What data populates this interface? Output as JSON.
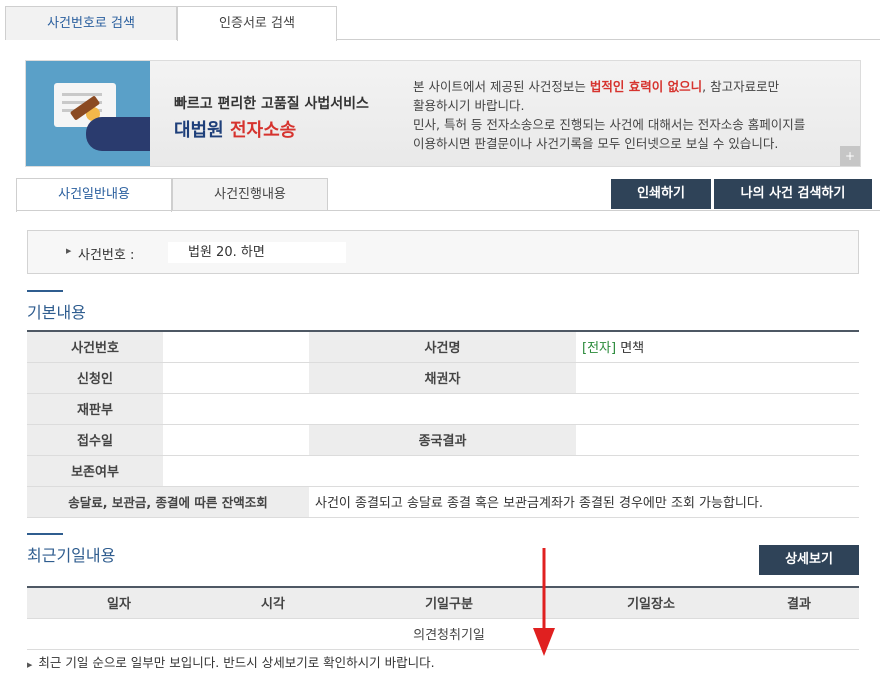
{
  "top_tabs": [
    "사건번호로 검색",
    "인증서로 검색"
  ],
  "banner": {
    "title1": "빠르고 편리한 고품질 사법서비스",
    "title2_a": "대법원",
    "title2_b": "전자소송",
    "text_line1_a": "본 사이트에서 제공된 사건정보는 ",
    "text_line1_red": "법적인 효력이 없으니",
    "text_line1_b": ", 참고자료로만",
    "text_line2": "활용하시기 바랍니다.",
    "text_line3": "민사, 특허 등 전자소송으로 진행되는 사건에 대해서는 전자소송 홈페이지를",
    "text_line4": "이용하시면 판결문이나 사건기록을 모두 인터넷으로 보실 수 있습니다.",
    "plus": "+"
  },
  "detail_tabs": [
    "사건일반내용",
    "사건진행내용"
  ],
  "buttons": {
    "print": "인쇄하기",
    "my_case": "나의 사건 검색하기",
    "detail": "상세보기"
  },
  "case_box": {
    "label": "사건번호 :",
    "value": "법원 20.   하면"
  },
  "basic": {
    "title": "기본내용",
    "rows": [
      {
        "k1": "사건번호",
        "v1": "",
        "k2": "사건명",
        "v2_tag": "[전자]",
        "v2": " 면책"
      },
      {
        "k1": "신청인",
        "v1": "",
        "k2": "채권자",
        "v2": ""
      },
      {
        "k1": "재판부",
        "v1": ""
      },
      {
        "k1": "접수일",
        "v1": "",
        "k2": "종국결과",
        "v2": ""
      },
      {
        "k1": "보존여부",
        "v1": ""
      },
      {
        "k1": "송달료, 보관금, 종결에 따른 잔액조회",
        "v1": "사건이 종결되고 송달료 종결 혹은 보관금계좌가 종결된 경우에만 조회 가능합니다."
      }
    ]
  },
  "recent": {
    "title": "최근기일내용",
    "headers": [
      "일자",
      "시각",
      "기일구분",
      "기일장소",
      "결과"
    ],
    "row": [
      "",
      "",
      "의견청취기일",
      "",
      ""
    ],
    "note": "최근 기일 순으로 일부만 보입니다. 반드시 상세보기로 확인하시기 바랍니다."
  },
  "colors": {
    "accent": "#2f5d8f",
    "button": "#2f4358",
    "red": "#d6332e",
    "green": "#2a8a3a"
  },
  "icons": [
    "gavel-icon",
    "arrow-icon",
    "plus-icon"
  ]
}
